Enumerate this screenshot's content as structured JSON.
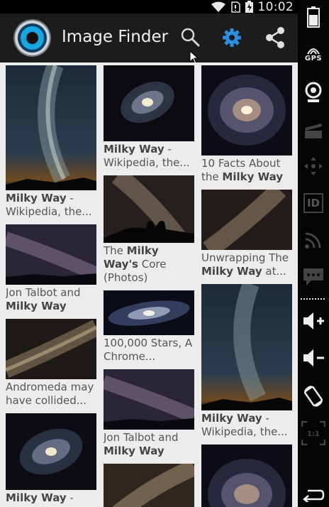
{
  "status_bar": {
    "time": "10:02"
  },
  "action_bar": {
    "title": "Image Finder",
    "search_icon": "search-icon",
    "settings_icon": "gear-icon",
    "share_icon": "share-icon"
  },
  "colors": {
    "accent": "#2e8fe0",
    "action_bar_bg": "#1c1c1c",
    "grid_bg": "#ececec",
    "caption_text": "#555555"
  },
  "results": [
    {
      "column": 1,
      "pre": "",
      "bold": "Milky Way",
      "post": " - Wikipedia, the..."
    },
    {
      "column": 1,
      "pre": "Jon Talbot and ",
      "bold": "Milky Way",
      "post": ""
    },
    {
      "column": 1,
      "pre": "Andromeda may have collided...",
      "bold": "",
      "post": ""
    },
    {
      "column": 1,
      "pre": "",
      "bold": "Milky Way",
      "post": " -"
    },
    {
      "column": 2,
      "pre": "",
      "bold": "Milky Way",
      "post": " - Wikipedia, the..."
    },
    {
      "column": 2,
      "pre": "The ",
      "bold": "Milky Way's",
      "post": " Core (Photos)"
    },
    {
      "column": 2,
      "pre": "100,000 Stars, A Chrome...",
      "bold": "",
      "post": ""
    },
    {
      "column": 2,
      "pre": "Jon Talbot and ",
      "bold": "Milky Way",
      "post": ""
    },
    {
      "column": 3,
      "pre": "10 Facts About the ",
      "bold": "Milky Way",
      "post": ""
    },
    {
      "column": 3,
      "pre": "Unwrapping The ",
      "bold": "Milky Way",
      "post": " at..."
    },
    {
      "column": 3,
      "pre": "",
      "bold": "Milky Way",
      "post": " - Wikipedia, the..."
    },
    {
      "column": 3,
      "pre": "",
      "bold": "",
      "post": ""
    }
  ],
  "side_toolbar": {
    "items": [
      "battery-icon",
      "gps-icon",
      "webcam-icon",
      "clapperboard-icon",
      "dpad-icon",
      "device-id-icon",
      "network-icon",
      "sms-icon",
      "volume-up-icon",
      "volume-down-icon",
      "rotate-icon",
      "scale-icon",
      "back-icon"
    ],
    "gps_label": "GPS",
    "id_label": "ID",
    "scale_label": "1:1"
  }
}
